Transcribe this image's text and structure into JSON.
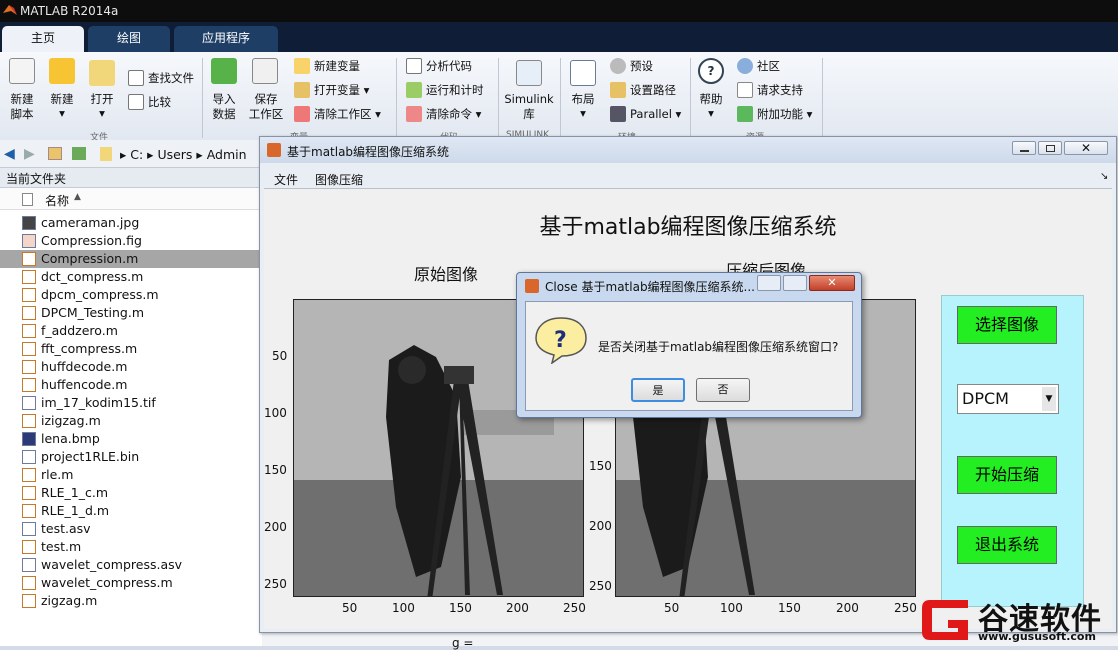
{
  "app": {
    "title": "MATLAB R2014a"
  },
  "tabs": [
    {
      "label": "主页"
    },
    {
      "label": "绘图"
    },
    {
      "label": "应用程序"
    }
  ],
  "ribbon": {
    "file": {
      "new_script": "新建\n脚本",
      "new": "新建",
      "open": "打开",
      "find_files": "查找文件",
      "compare": "比较",
      "group": "文件"
    },
    "variable": {
      "import": "导入\n数据",
      "save": "保存\n工作区",
      "new_var": "新建变量",
      "open_var": "打开变量",
      "clear_ws": "清除工作区",
      "group": "变量"
    },
    "code": {
      "analyze": "分析代码",
      "run_time": "运行和计时",
      "clear_cmd": "清除命令",
      "group": "代码"
    },
    "simulink": {
      "label": "Simulink\n库",
      "group": "SIMULINK"
    },
    "env": {
      "layout": "布局",
      "prefs": "预设",
      "setpath": "设置路径",
      "parallel": "Parallel",
      "group": "环境"
    },
    "resources": {
      "help": "帮助",
      "community": "社区",
      "support": "请求支持",
      "addons": "附加功能",
      "group": "资源"
    }
  },
  "path": {
    "parts": [
      "C:",
      "Users",
      "Admin"
    ]
  },
  "current_folder": {
    "title": "当前文件夹",
    "col_name": "名称",
    "files": [
      "cameraman.jpg",
      "Compression.fig",
      "Compression.m",
      "dct_compress.m",
      "dpcm_compress.m",
      "DPCM_Testing.m",
      "f_addzero.m",
      "fft_compress.m",
      "huffdecode.m",
      "huffencode.m",
      "im_17_kodim15.tif",
      "izigzag.m",
      "lena.bmp",
      "project1RLE.bin",
      "rle.m",
      "RLE_1_c.m",
      "RLE_1_d.m",
      "test.asv",
      "test.m",
      "wavelet_compress.asv",
      "wavelet_compress.m",
      "zigzag.m"
    ],
    "selected": "Compression.m"
  },
  "figure": {
    "title": "基于matlab编程图像压缩系统",
    "menu": [
      "文件",
      "图像压缩"
    ],
    "heading": "基于matlab编程图像压缩系统",
    "orig_title": "原始图像",
    "comp_title": "压缩后图像",
    "yticks": [
      "50",
      "100",
      "150",
      "200",
      "250"
    ],
    "xticks": [
      "50",
      "100",
      "150",
      "200",
      "250"
    ],
    "buttons": {
      "select": "选择图像",
      "start": "开始压缩",
      "exit": "退出系统"
    },
    "method": "DPCM"
  },
  "dialog": {
    "title": "Close 基于matlab编程图像压缩系统...",
    "message": "是否关闭基于matlab编程图像压缩系统窗口?",
    "yes": "是",
    "no": "否"
  },
  "cmd_line": "g =",
  "watermark": {
    "name": "谷速软件",
    "url": "www.gususoft.com"
  },
  "colors": {
    "titlebar": "#0d0d0d",
    "tabs": "#0f1e36",
    "accent_button": "#22ee22",
    "panel_bg": "#b7f3fd"
  }
}
